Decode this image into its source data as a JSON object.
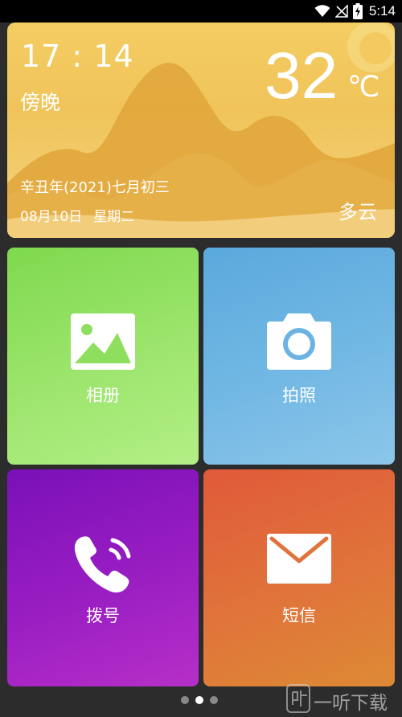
{
  "status_bar": {
    "time": "5:14",
    "icons": [
      "wifi-icon",
      "no-signal-icon",
      "battery-charging-icon"
    ]
  },
  "weather": {
    "time": "17 : 14",
    "period": "傍晚",
    "temperature": "32",
    "unit": "℃",
    "lunar_date": "辛丑年(2021)七月初三",
    "date": "08月10日",
    "weekday": "星期二",
    "condition": "多云"
  },
  "tiles": [
    {
      "label": "相册",
      "icon": "photo-album-icon",
      "color": "#8fdf5e"
    },
    {
      "label": "拍照",
      "icon": "camera-icon",
      "color": "#6bb3e2"
    },
    {
      "label": "拨号",
      "icon": "phone-icon",
      "color": "#9a1ec2"
    },
    {
      "label": "短信",
      "icon": "envelope-icon",
      "color": "#e0723a"
    }
  ],
  "pager": {
    "total": 3,
    "active": 2
  },
  "watermark": {
    "text": "一听下载",
    "icon": "watermark-logo-icon"
  }
}
